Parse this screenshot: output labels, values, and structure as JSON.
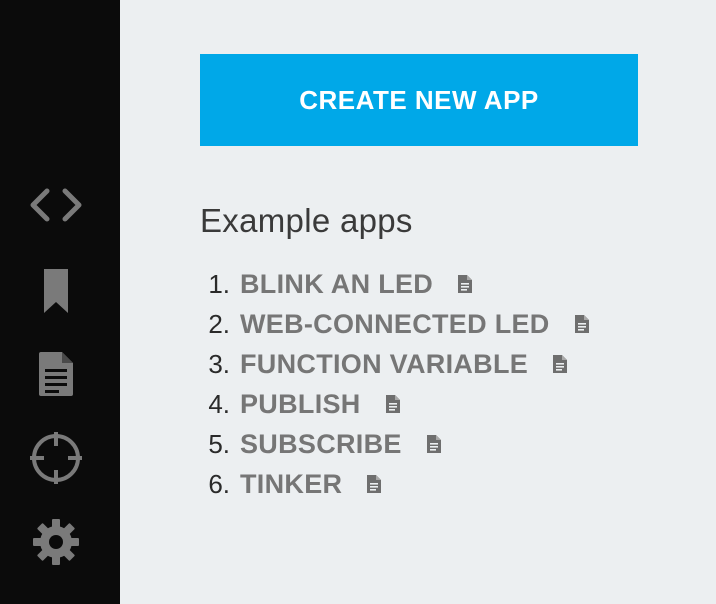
{
  "sidebar": {
    "icons": [
      {
        "name": "code-icon"
      },
      {
        "name": "bookmark-icon"
      },
      {
        "name": "document-icon"
      },
      {
        "name": "crosshair-icon"
      },
      {
        "name": "gear-icon"
      }
    ],
    "icon_color": "#7a7a7a",
    "background": "#0b0b0b"
  },
  "main": {
    "create_button_label": "CREATE NEW APP",
    "create_button_color": "#00a8e8",
    "section_title": "Example apps",
    "examples": [
      {
        "number": "1.",
        "label": "BLINK AN LED"
      },
      {
        "number": "2.",
        "label": "WEB-CONNECTED LED"
      },
      {
        "number": "3.",
        "label": "FUNCTION VARIABLE"
      },
      {
        "number": "4.",
        "label": "PUBLISH"
      },
      {
        "number": "5.",
        "label": "SUBSCRIBE"
      },
      {
        "number": "6.",
        "label": "TINKER"
      }
    ]
  }
}
